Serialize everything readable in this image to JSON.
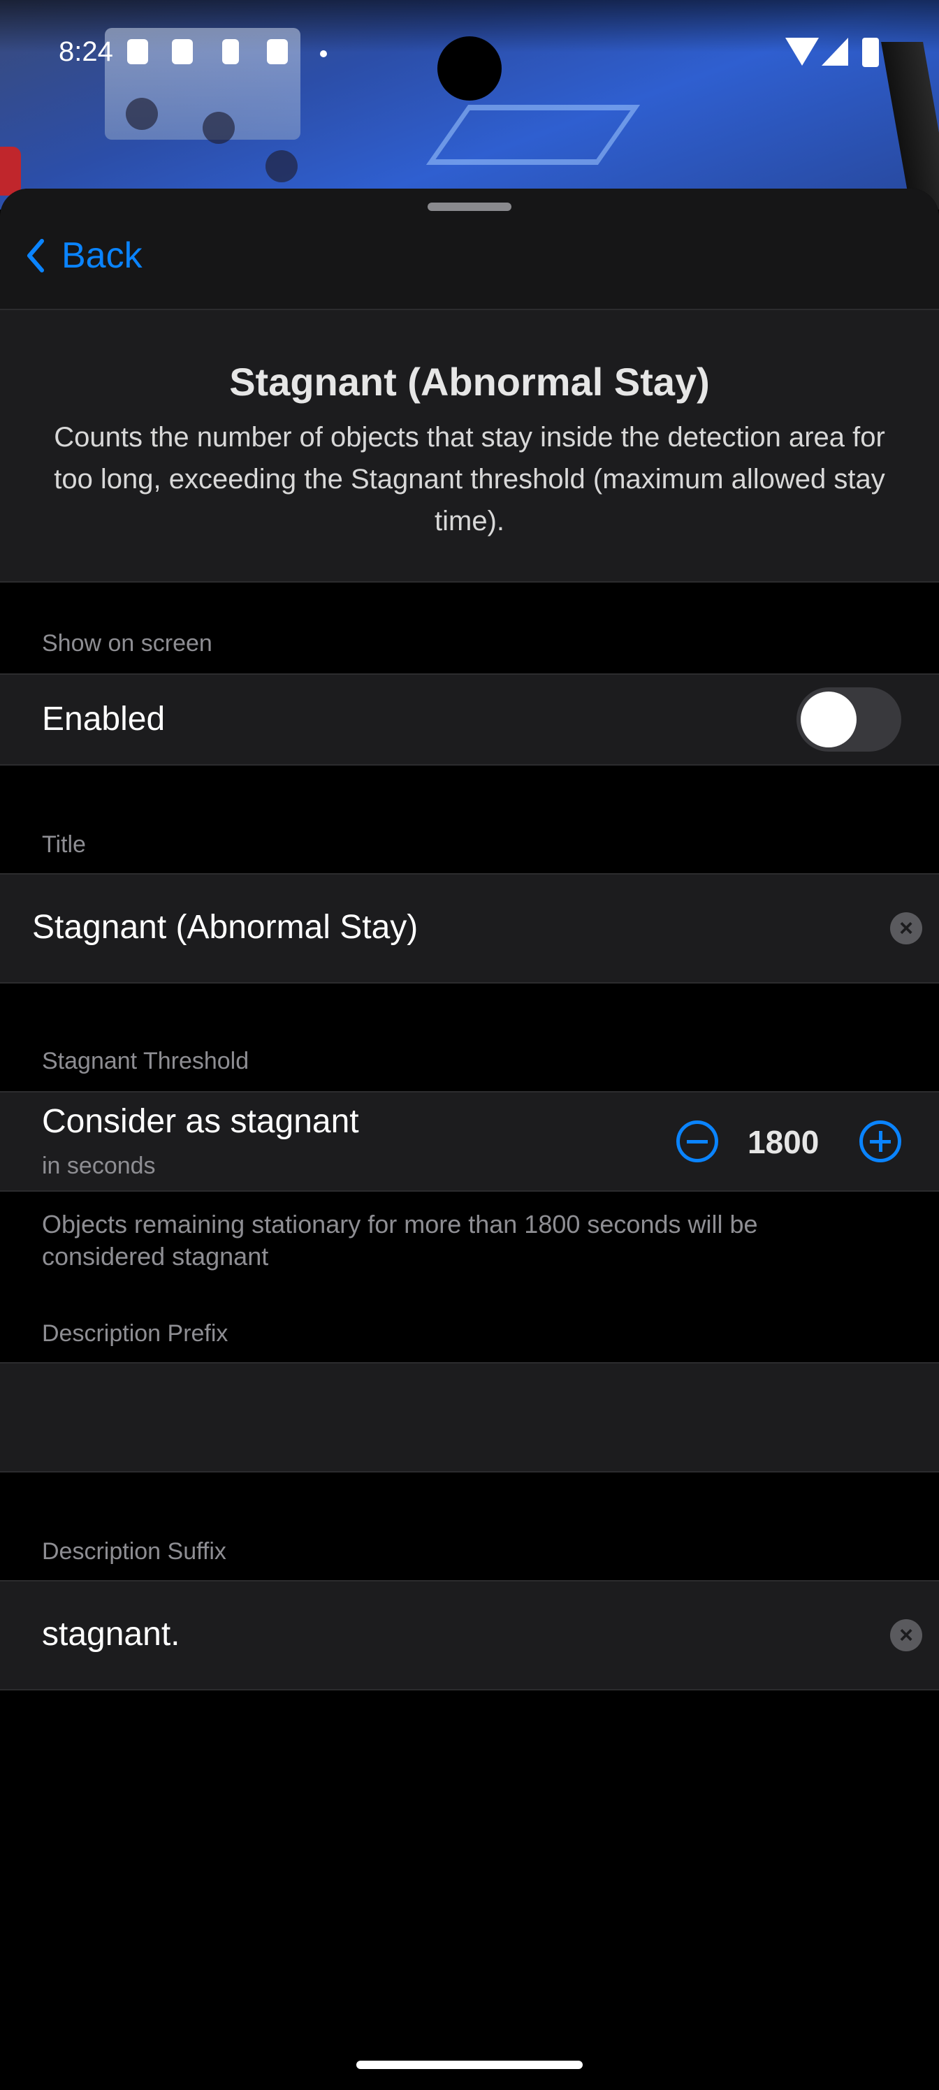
{
  "status_bar": {
    "time": "8:24"
  },
  "nav": {
    "back_label": "Back"
  },
  "header": {
    "title": "Stagnant (Abnormal Stay)",
    "description": "Counts the number of objects that stay inside the detection area for too long, exceeding the Stagnant threshold (maximum allowed stay time)."
  },
  "show_on_screen": {
    "section_label": "Show on screen",
    "enabled_label": "Enabled",
    "enabled": false
  },
  "title_field": {
    "section_label": "Title",
    "value": "Stagnant (Abnormal Stay)"
  },
  "threshold": {
    "section_label": "Stagnant Threshold",
    "label": "Consider as stagnant",
    "sublabel": "in seconds",
    "value": "1800",
    "footnote": "Objects remaining stationary for more than 1800 seconds will be considered stagnant"
  },
  "description_prefix": {
    "section_label": "Description Prefix",
    "value": ""
  },
  "description_suffix": {
    "section_label": "Description Suffix",
    "value": "stagnant."
  },
  "colors": {
    "accent": "#0a84ff",
    "background": "#000000",
    "row_background": "#1c1c1e",
    "secondary_text": "#8e8e93"
  }
}
